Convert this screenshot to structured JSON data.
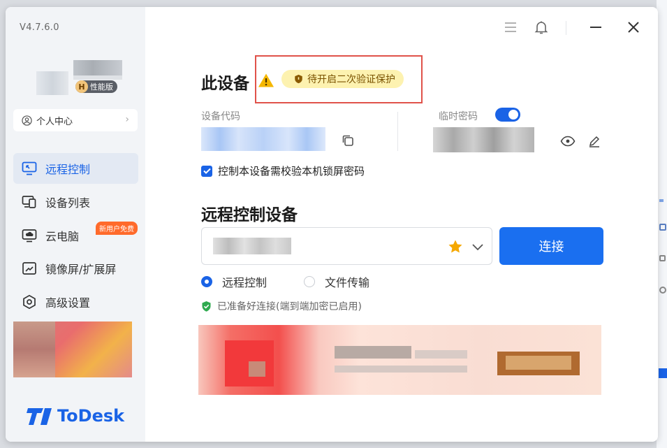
{
  "app": {
    "version": "V4.7.6.0",
    "edition_badge_letter": "H",
    "edition_badge_label": "性能版",
    "brand": "ToDesk",
    "brand_color": "#1a63e6"
  },
  "sidebar": {
    "personal_center": "个人中心",
    "items": [
      {
        "label": "远程控制",
        "icon": "monitor-remote-icon",
        "active": true
      },
      {
        "label": "设备列表",
        "icon": "devices-icon",
        "active": false
      },
      {
        "label": "云电脑",
        "icon": "cloud-pc-icon",
        "active": false,
        "tag": "新用户免费"
      },
      {
        "label": "镜像屏/扩展屏",
        "icon": "mirror-screen-icon",
        "active": false
      },
      {
        "label": "高级设置",
        "icon": "settings-icon",
        "active": false
      }
    ]
  },
  "this_device": {
    "title": "此设备",
    "warning_badge": "待开启二次验证保护",
    "device_code_label": "设备代码",
    "temp_password_label": "临时密码",
    "temp_password_enabled": true,
    "lock_screen_check_label": "控制本设备需校验本机锁屏密码",
    "lock_screen_checked": true
  },
  "remote_control": {
    "title": "远程控制设备",
    "connect_button": "连接",
    "modes": [
      {
        "label": "远程控制",
        "selected": true
      },
      {
        "label": "文件传输",
        "selected": false
      }
    ],
    "status": "已准备好连接(端到端加密已启用)"
  }
}
